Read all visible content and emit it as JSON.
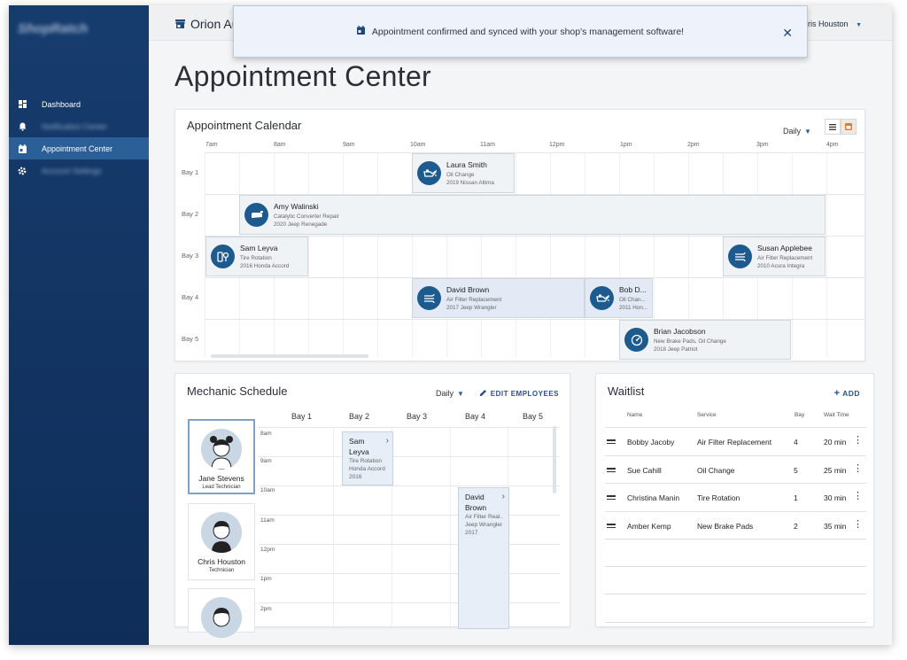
{
  "sidebar": {
    "logo": "ShopRatch",
    "items": [
      {
        "label": "Dashboard",
        "icon": "dashboard-icon",
        "active": false
      },
      {
        "label": "Notification Center",
        "icon": "bell-icon",
        "active": false,
        "blurred": true
      },
      {
        "label": "Appointment Center",
        "icon": "calendar-icon",
        "active": true
      },
      {
        "label": "Account Settings",
        "icon": "gear-icon",
        "active": false,
        "blurred": true
      }
    ]
  },
  "topbar": {
    "shop_name": "Orion Au",
    "user_name": "hris Houston"
  },
  "toast": {
    "message": "Appointment confirmed and synced with your shop's management software!"
  },
  "page": {
    "title": "Appointment Center"
  },
  "calendar": {
    "title": "Appointment Calendar",
    "view": "Daily",
    "times": [
      "7am",
      "8am",
      "9am",
      "10am",
      "11am",
      "12pm",
      "1pm",
      "2pm",
      "3pm",
      "4pm"
    ],
    "bays": [
      "Bay 1",
      "Bay 2",
      "Bay 3",
      "Bay 4",
      "Bay 5"
    ],
    "appointments": [
      {
        "name": "Laura Smith",
        "service": "Oil Change",
        "vehicle": "2019 Nissan Altima",
        "icon": "oil-can-icon"
      },
      {
        "name": "Amy Walinski",
        "service": "Catalytic Converter Repair",
        "vehicle": "2020 Jeep Renegade",
        "icon": "exhaust-icon"
      },
      {
        "name": "Sam Leyva",
        "service": "Tire Rotation",
        "vehicle": "2016 Honda Accord",
        "icon": "tire-icon"
      },
      {
        "name": "Susan Applebee",
        "service": "Air Filter Replacement",
        "vehicle": "2010 Acura Integra",
        "icon": "air-filter-icon"
      },
      {
        "name": "David Brown",
        "service": "Air Filter Replacement",
        "vehicle": "2017 Jeep Wrangler",
        "icon": "air-filter-icon"
      },
      {
        "name": "Bob D...",
        "service": "Oil Chan...",
        "vehicle": "2011 Hon...",
        "icon": "oil-can-icon"
      },
      {
        "name": "Brian Jacobson",
        "service": "New Brake Pads, Oil Change",
        "vehicle": "2018 Jeep Patriot",
        "icon": "brake-gauge-icon"
      }
    ]
  },
  "mechanic": {
    "title": "Mechanic Schedule",
    "view": "Daily",
    "edit_label": "EDIT EMPLOYEES",
    "bays": [
      "Bay 1",
      "Bay 2",
      "Bay 3",
      "Bay 4",
      "Bay 5"
    ],
    "hours": [
      "8am",
      "9am",
      "10am",
      "11am",
      "12pm",
      "1pm",
      "2pm"
    ],
    "employees": [
      {
        "name": "Jane Stevens",
        "role": "Lead Technician"
      },
      {
        "name": "Chris Houston",
        "role": "Technician"
      },
      {
        "name": "",
        "role": ""
      }
    ],
    "appointments": [
      {
        "name": "Sam Leyva",
        "service": "Tire Rotation",
        "vehicle": "Honda Accord 2016"
      },
      {
        "name": "David Brown",
        "service": "Air Filter Real...",
        "vehicle": "Jeep Wrangler 2017"
      }
    ]
  },
  "waitlist": {
    "title": "Waitlist",
    "add_label": "ADD",
    "columns": [
      "Name",
      "Service",
      "Bay",
      "Wait Time"
    ],
    "rows": [
      {
        "name": "Bobby Jacoby",
        "service": "Air Filter Replacement",
        "bay": "4",
        "wait": "20 min"
      },
      {
        "name": "Sue Cahill",
        "service": "Oil Change",
        "bay": "5",
        "wait": "25 min"
      },
      {
        "name": "Christina Manin",
        "service": "Tire Rotation",
        "bay": "1",
        "wait": "30 min"
      },
      {
        "name": "Amber Kemp",
        "service": "New Brake Pads",
        "bay": "2",
        "wait": "35 min"
      }
    ]
  },
  "colors": {
    "sidebar": "#163c6e",
    "active_nav": "#2a5f97",
    "accent": "#1d5b8f"
  }
}
